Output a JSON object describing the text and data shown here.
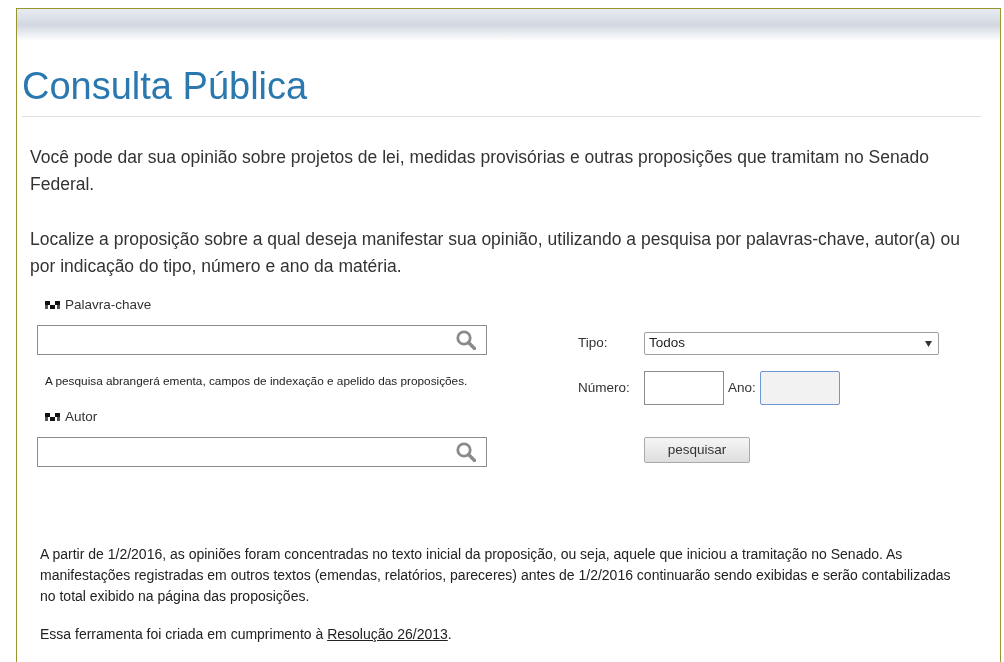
{
  "header": {
    "title": "Consulta Pública"
  },
  "intro": [
    "Você pode dar sua opinião sobre projetos de lei, medidas provisórias e outras proposições que tramitam no Senado Federal.",
    "Localize a proposição sobre a qual deseja manifestar sua opinião, utilizando a pesquisa por palavras-chave, autor(a) ou por indicação do tipo, número e ano da matéria."
  ],
  "search_by_text": [
    {
      "label": "Palavra-chave",
      "hint": "A pesquisa abrangerá ementa, campos de indexação e apelido das proposições."
    },
    {
      "label": "Autor"
    }
  ],
  "search_by_id": {
    "type": {
      "label": "Tipo:",
      "value": "Todos"
    },
    "number": {
      "label": "Número:",
      "focused": false
    },
    "year": {
      "label": "Ano:",
      "focused": true
    },
    "button": "pesquisar"
  },
  "notes": [
    {
      "text": "A partir de 1/2/2016, as opiniões foram concentradas no texto inicial da proposição, ou seja, aquele que iniciou a tramitação no Senado. As manifestações registradas em outros textos (emendas, relatórios, pareceres) antes de 1/2/2016 continuarão sendo exibidas e serão contabilizadas no total exibido na página das proposições."
    },
    {
      "text": "Essa ferramenta foi criada em cumprimento à ",
      "link": "Resolução 26/2013",
      "text_after": "."
    }
  ]
}
